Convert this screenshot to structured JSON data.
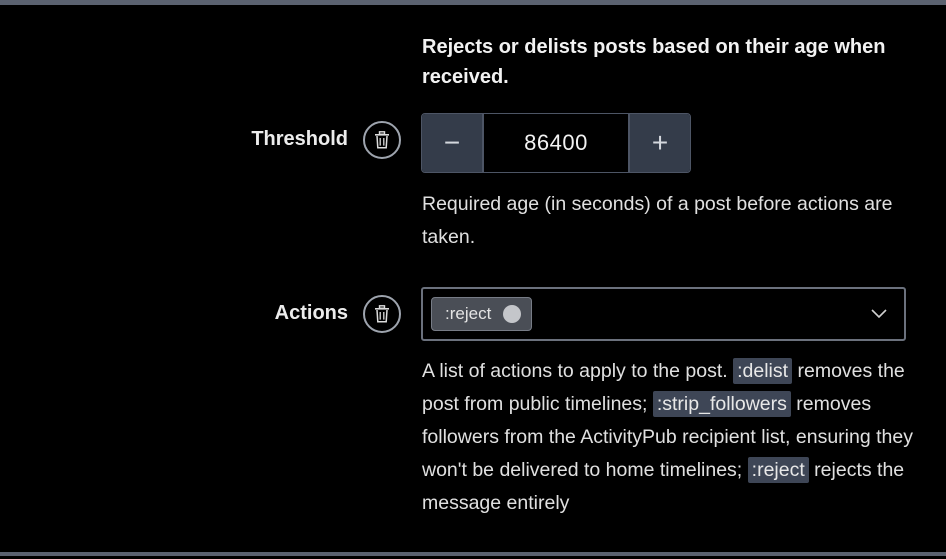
{
  "section": {
    "description": "Rejects or delists posts based on their age when received."
  },
  "threshold": {
    "label": "Threshold",
    "value": "86400",
    "decrement_symbol": "−",
    "increment_symbol": "+",
    "help": "Required age (in seconds) of a post before actions are taken."
  },
  "actions": {
    "label": "Actions",
    "selected_tags": [
      ":reject"
    ],
    "help": {
      "part1": "A list of actions to apply to the post. ",
      "code1": ":delist",
      "part2": " removes the post from public timelines; ",
      "code2": ":strip_followers",
      "part3": " removes followers from the ActivityPub recipient list, ensuring they won't be delivered to home timelines; ",
      "code3": ":reject",
      "part4": " rejects the message entirely"
    }
  },
  "icons": {
    "delete": "trash-icon",
    "dropdown": "chevron-down-icon",
    "tag_remove": "close-icon"
  },
  "colors": {
    "background": "#000000",
    "button_bg": "#343c4a",
    "code_bg": "#3e4656",
    "divider": "#5b6270"
  }
}
